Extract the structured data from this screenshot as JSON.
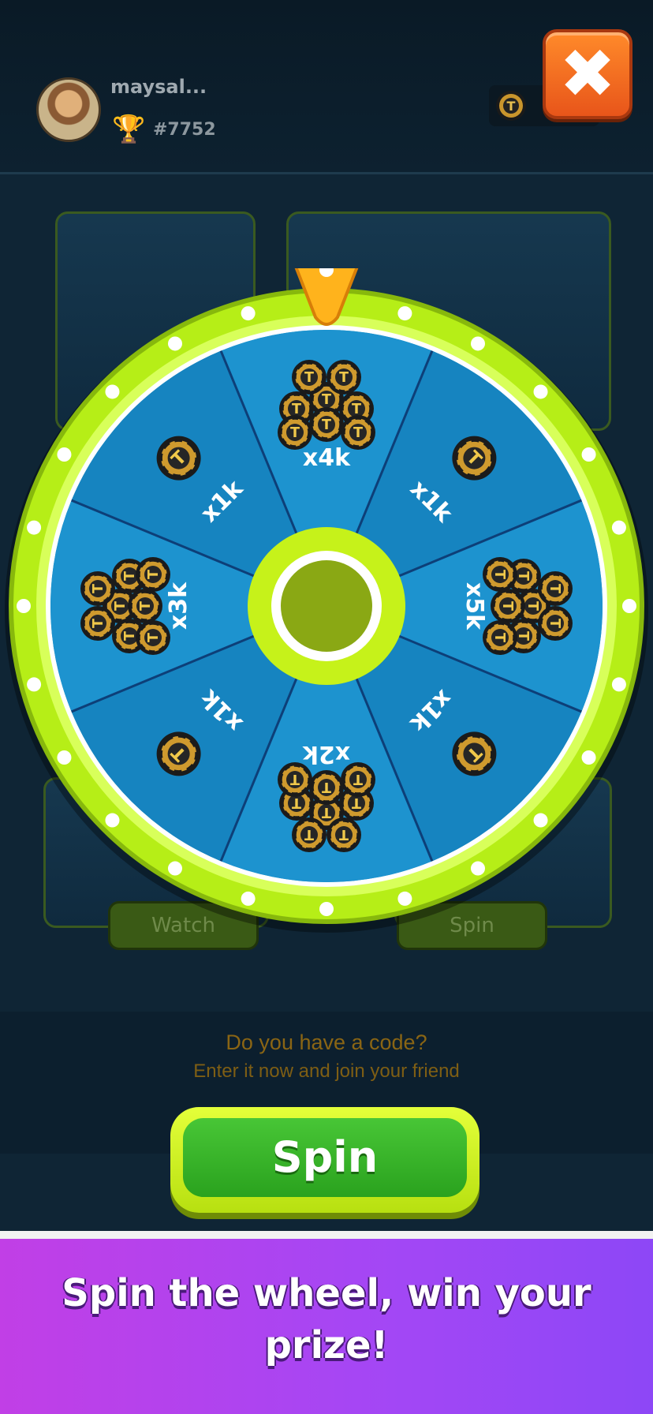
{
  "header": {
    "username": "maysal...",
    "rank": "#7752",
    "trophy_icon": "trophy-icon",
    "coin_icon": "coin-icon"
  },
  "close_button": {
    "icon": "close-icon",
    "color": "#ff7a22"
  },
  "background": {
    "watch_label": "Watch",
    "spin_label": "Spin",
    "code_question": "Do you have a code?",
    "code_subtitle": "Enter it now and join your friend"
  },
  "wheel": {
    "colors": {
      "rim": "#b6ee17",
      "face": "#1b8ec8",
      "divider": "#0d3f78",
      "hub": "#8aa814",
      "pointer": "#ffb31c"
    },
    "segments": [
      {
        "label": "x4k",
        "prize": "coin-pile"
      },
      {
        "label": "x1k",
        "prize": "single-coin"
      },
      {
        "label": "x5k",
        "prize": "coin-pile"
      },
      {
        "label": "x1k",
        "prize": "single-coin"
      },
      {
        "label": "x2k",
        "prize": "coin-pile"
      },
      {
        "label": "x1k",
        "prize": "single-coin"
      },
      {
        "label": "x3k",
        "prize": "coin-pile"
      },
      {
        "label": "x1k",
        "prize": "single-coin"
      }
    ]
  },
  "spin_button": {
    "label": "Spin"
  },
  "banner": {
    "text": "Spin the wheel, win your prize!"
  }
}
